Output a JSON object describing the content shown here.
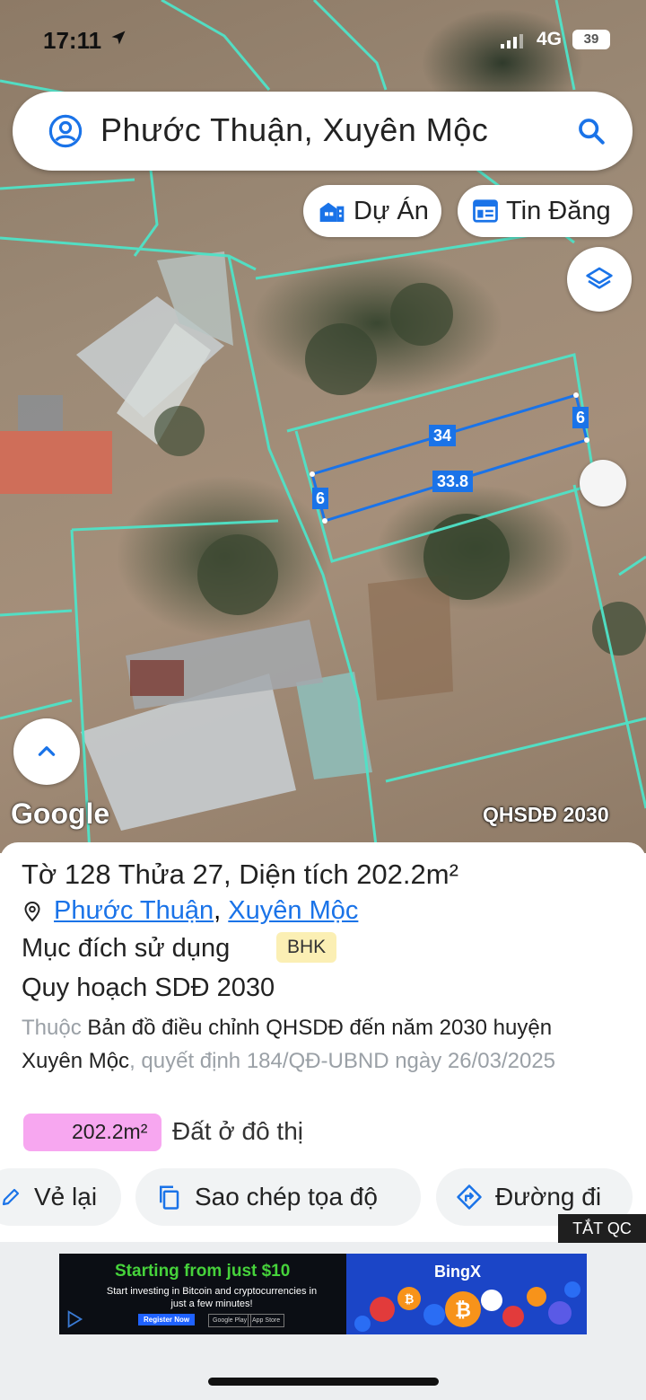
{
  "status_bar": {
    "time": "17:11",
    "network": "4G",
    "battery": "39"
  },
  "search": {
    "query": "Phước Thuận, Xuyên Mộc"
  },
  "chips": {
    "du_an": "Dự Án",
    "tin_dang": "Tin Đăng"
  },
  "map": {
    "attribution": "Google",
    "overlay_label": "QHSDĐ 2030",
    "measurements": {
      "top": "34",
      "bottom": "33.8",
      "left": "6",
      "right": "6"
    },
    "parcel_line_color": "#4fe3c8",
    "measure_color": "#1a73e8"
  },
  "parcel": {
    "to_label": "Tờ",
    "to_value": "128",
    "thua_label": "Thửa",
    "thua_value": "27",
    "dien_tich_label": "Diện tích",
    "dien_tich_value": "202.2m²",
    "ward": "Phước Thuận",
    "separator": ",",
    "district": "Xuyên Mộc",
    "muc_dich_label": "Mục đích sử dụng",
    "muc_dich_badge": "BHK",
    "quy_hoach_label": "Quy hoạch SDĐ 2030",
    "thuoc": "Thuộc",
    "ban_do": "Bản đồ điều chỉnh QHSDĐ đến năm 2030 huyện Xuyên Mộc",
    "quyet_dinh": ", quyết định 184/QĐ-UBND ngày 26/03/2025",
    "area_value": "202.2m²",
    "area_type": "Đất ở đô thị",
    "area_color": "#f7a7f0"
  },
  "actions": {
    "redraw": "Vẻ lại",
    "copy_coords": "Sao chép tọa độ",
    "directions": "Đường đi"
  },
  "ad": {
    "close_label": "TẮT QC",
    "headline": "Starting from just $10",
    "body": "Start investing in Bitcoin and cryptocurrencies in just a few minutes!",
    "cta": "Register Now",
    "store1": "Google Play",
    "store2": "App Store",
    "brand": "BingX"
  }
}
